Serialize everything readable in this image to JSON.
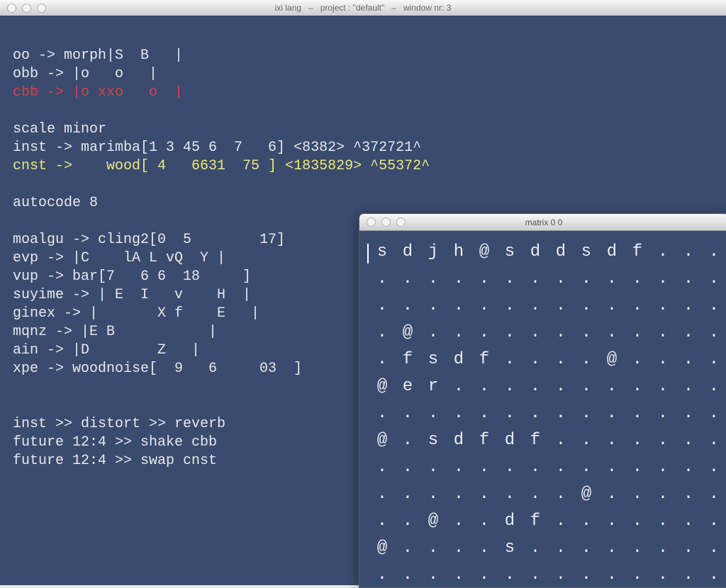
{
  "main_window": {
    "title_left": "ixi lang",
    "title_mid": "project : \"default\"",
    "title_right": "window nr: 3"
  },
  "code_lines": [
    {
      "color": "white",
      "text": ""
    },
    {
      "color": "white",
      "text": "oo -> morph|S  B   |"
    },
    {
      "color": "white",
      "text": "obb -> |o   o   |"
    },
    {
      "color": "red",
      "text": "cbb -> |o xxo   o  |"
    },
    {
      "color": "white",
      "text": ""
    },
    {
      "color": "white",
      "text": "scale minor"
    },
    {
      "color": "white",
      "text": "inst -> marimba[1 3 45 6  7   6] <8382> ^372721^"
    },
    {
      "color": "yellow",
      "text": "cnst ->    wood[ 4   6631  75 ] <1835829> ^55372^"
    },
    {
      "color": "white",
      "text": ""
    },
    {
      "color": "white",
      "text": "autocode 8"
    },
    {
      "color": "white",
      "text": ""
    },
    {
      "color": "white",
      "text": "moalgu -> cling2[0  5        17]"
    },
    {
      "color": "white",
      "text": "evp -> |C    lA L vQ  Y |"
    },
    {
      "color": "white",
      "text": "vup -> bar[7   6 6  18     ]"
    },
    {
      "color": "white",
      "text": "suyime -> | E  I   v    H  |"
    },
    {
      "color": "white",
      "text": "ginex -> |       X f    E   |"
    },
    {
      "color": "white",
      "text": "mqnz -> |E B           |"
    },
    {
      "color": "white",
      "text": "ain -> |D        Z   |"
    },
    {
      "color": "white",
      "text": "xpe -> woodnoise[  9   6     03  ]"
    },
    {
      "color": "white",
      "text": ""
    },
    {
      "color": "white",
      "text": ""
    },
    {
      "color": "white",
      "text": "inst >> distort >> reverb"
    },
    {
      "color": "white",
      "text": "future 12:4 >> shake cbb"
    },
    {
      "color": "white",
      "text": "future 12:4 >> swap cnst"
    }
  ],
  "matrix_window": {
    "title": "matrix 0 0",
    "grid": [
      [
        "s",
        "d",
        "j",
        "h",
        "@",
        "s",
        "d",
        "d",
        "s",
        "d",
        "f",
        ".",
        ".",
        "."
      ],
      [
        ".",
        ".",
        ".",
        ".",
        ".",
        ".",
        ".",
        ".",
        ".",
        ".",
        ".",
        ".",
        ".",
        "."
      ],
      [
        ".",
        ".",
        ".",
        ".",
        ".",
        ".",
        ".",
        ".",
        ".",
        ".",
        ".",
        ".",
        ".",
        "."
      ],
      [
        ".",
        "@",
        ".",
        ".",
        ".",
        ".",
        ".",
        ".",
        ".",
        ".",
        ".",
        ".",
        ".",
        "."
      ],
      [
        ".",
        "f",
        "s",
        "d",
        "f",
        ".",
        ".",
        ".",
        ".",
        "@",
        ".",
        ".",
        ".",
        "."
      ],
      [
        "@",
        "e",
        "r",
        ".",
        ".",
        ".",
        ".",
        ".",
        ".",
        ".",
        ".",
        ".",
        ".",
        "."
      ],
      [
        ".",
        ".",
        ".",
        ".",
        ".",
        ".",
        ".",
        ".",
        ".",
        ".",
        ".",
        ".",
        ".",
        "."
      ],
      [
        "@",
        ".",
        "s",
        "d",
        "f",
        "d",
        "f",
        ".",
        ".",
        ".",
        ".",
        ".",
        ".",
        "."
      ],
      [
        ".",
        ".",
        ".",
        ".",
        ".",
        ".",
        ".",
        ".",
        ".",
        ".",
        ".",
        ".",
        ".",
        "."
      ],
      [
        ".",
        ".",
        ".",
        ".",
        ".",
        ".",
        ".",
        ".",
        "@",
        ".",
        ".",
        ".",
        ".",
        "."
      ],
      [
        ".",
        ".",
        "@",
        ".",
        ".",
        "d",
        "f",
        ".",
        ".",
        ".",
        ".",
        ".",
        ".",
        "."
      ],
      [
        "@",
        ".",
        ".",
        ".",
        ".",
        "s",
        ".",
        ".",
        ".",
        ".",
        ".",
        ".",
        ".",
        "."
      ],
      [
        ".",
        ".",
        ".",
        ".",
        ".",
        ".",
        ".",
        ".",
        ".",
        ".",
        ".",
        ".",
        ".",
        "."
      ]
    ]
  },
  "colors": {
    "editor_bg": "#394B6F",
    "text_white": "#E8E8E8",
    "text_red": "#DD4040",
    "text_yellow": "#F0E776"
  }
}
